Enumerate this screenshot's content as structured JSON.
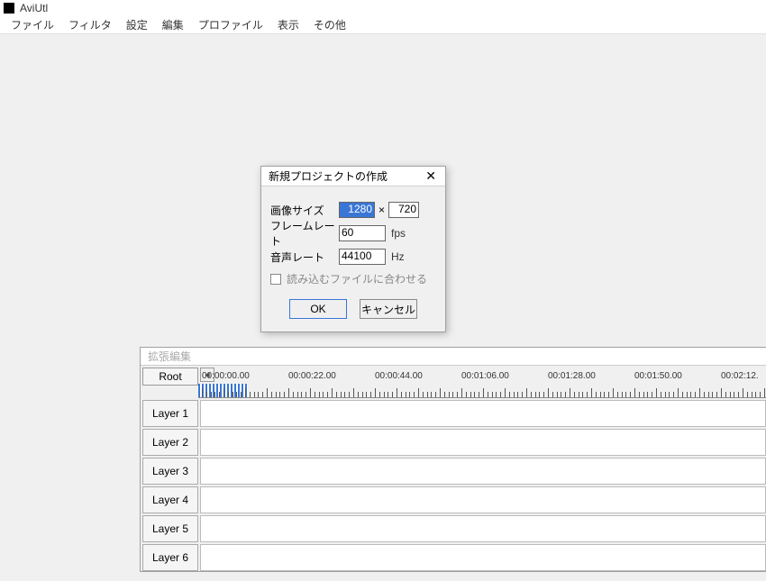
{
  "app": {
    "title": "AviUtl"
  },
  "menu": {
    "items": [
      "ファイル",
      "フィルタ",
      "設定",
      "編集",
      "プロファイル",
      "表示",
      "その他"
    ]
  },
  "dialog": {
    "title": "新規プロジェクトの作成",
    "rows": {
      "size_label": "画像サイズ",
      "width": "1280",
      "height": "720",
      "fps_label": "フレームレート",
      "fps_value": "60",
      "fps_unit": "fps",
      "audio_label": "音声レート",
      "audio_value": "44100",
      "audio_unit": "Hz",
      "times": "×"
    },
    "checkbox_label": "読み込むファイルに合わせる",
    "ok": "OK",
    "cancel": "キャンセル"
  },
  "timeline": {
    "title": "拡張編集",
    "root": "Root",
    "time_marks": [
      "00:00:00.00",
      "00:00:22.00",
      "00:00:44.00",
      "00:01:06.00",
      "00:01:28.00",
      "00:01:50.00",
      "00:02:12."
    ],
    "layers": [
      "Layer 1",
      "Layer 2",
      "Layer 3",
      "Layer 4",
      "Layer 5",
      "Layer 6"
    ]
  }
}
